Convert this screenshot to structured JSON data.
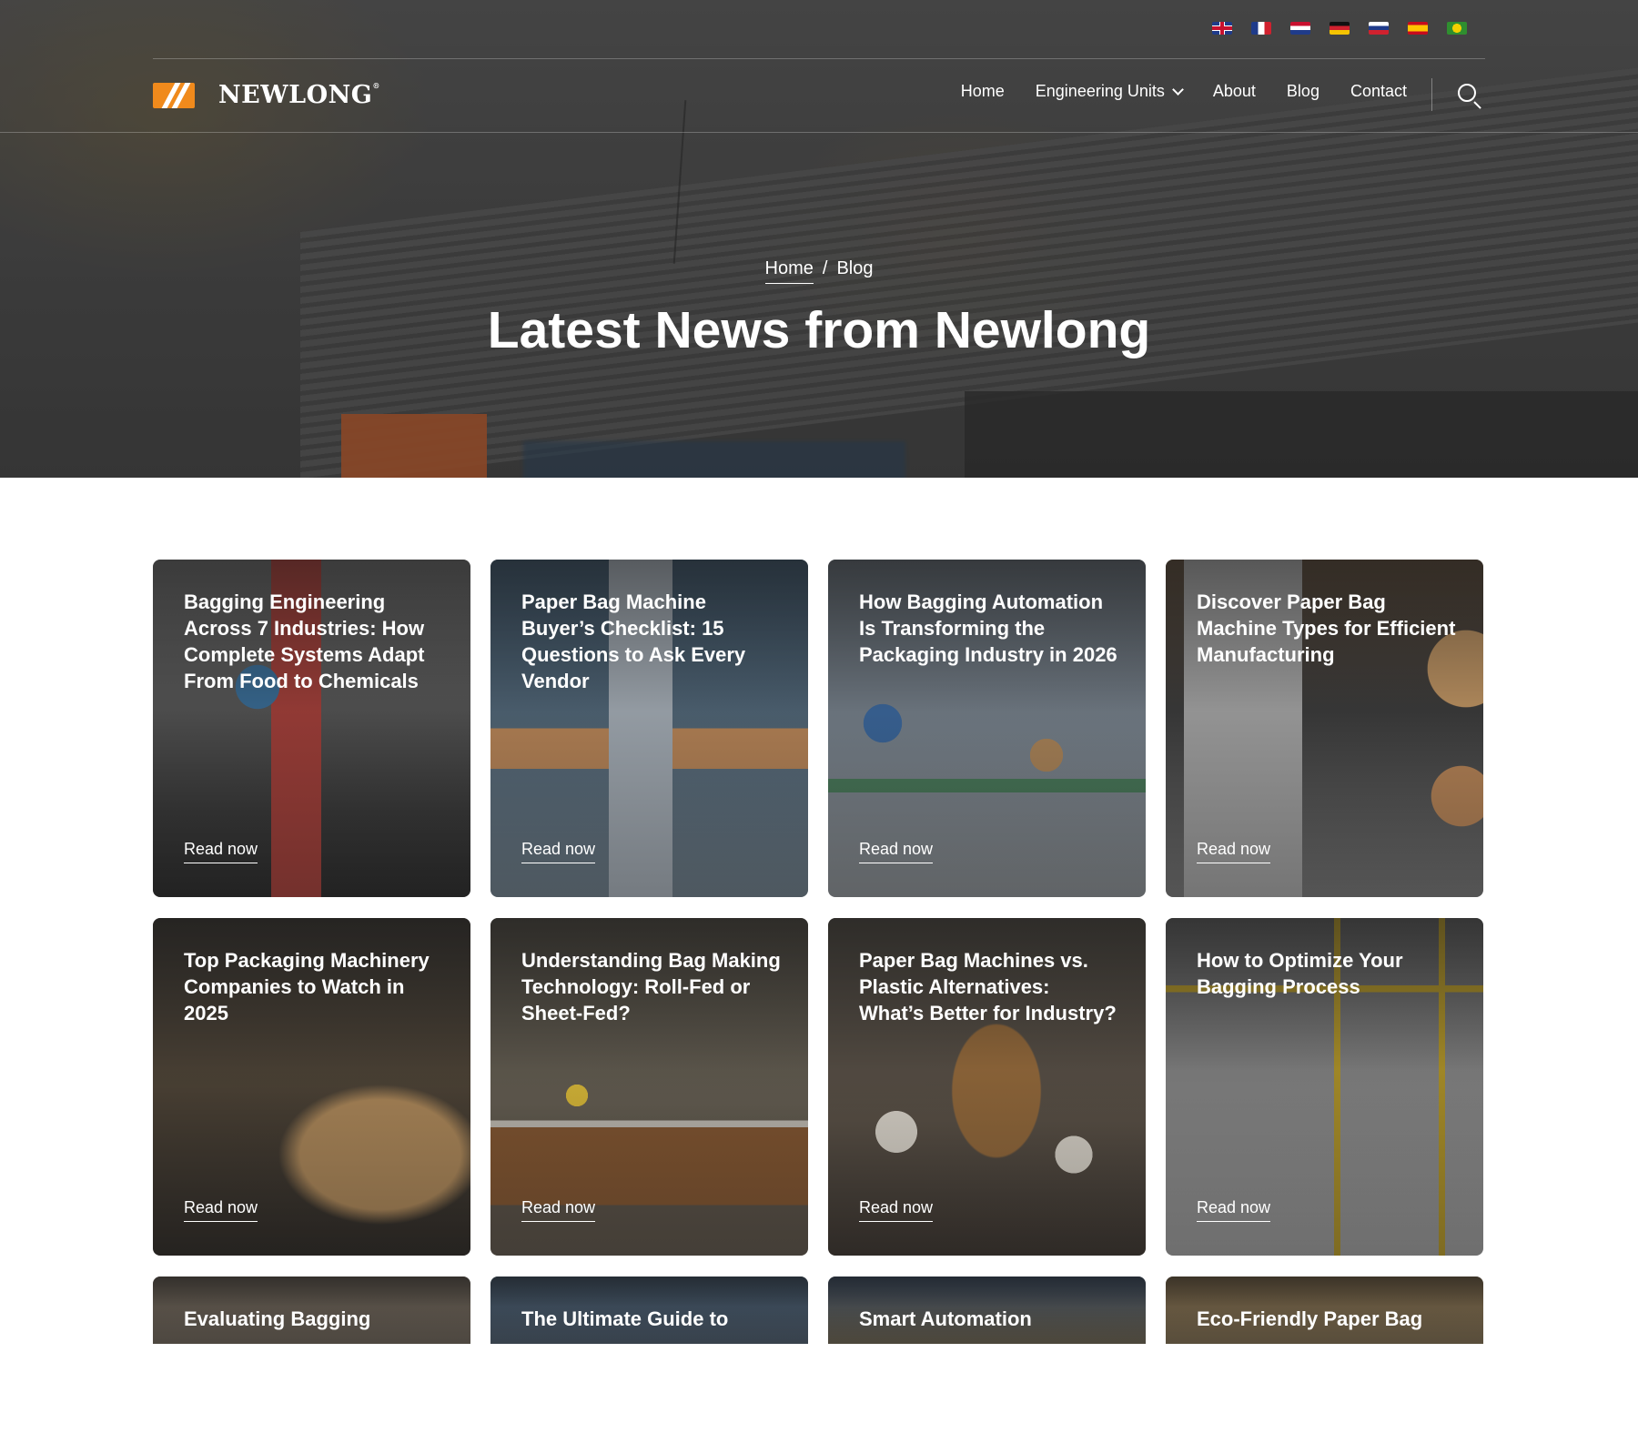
{
  "header": {
    "languages": [
      {
        "name": "English",
        "icon": "uk-flag-icon"
      },
      {
        "name": "French",
        "icon": "france-flag-icon"
      },
      {
        "name": "Dutch",
        "icon": "netherlands-flag-icon"
      },
      {
        "name": "German",
        "icon": "germany-flag-icon"
      },
      {
        "name": "Russian",
        "icon": "russia-flag-icon"
      },
      {
        "name": "Spanish",
        "icon": "spain-flag-icon"
      },
      {
        "name": "Portuguese",
        "icon": "brazil-flag-icon"
      }
    ],
    "logo_text": "NEWLONG",
    "logo_mark": "®",
    "nav": {
      "home": "Home",
      "engineering_units": "Engineering Units",
      "about": "About",
      "blog": "Blog",
      "contact": "Contact"
    }
  },
  "hero": {
    "breadcrumb": {
      "home": "Home",
      "separator": "/",
      "current": "Blog"
    },
    "title": "Latest News from Newlong"
  },
  "cards": [
    {
      "title": "Bagging Engineering Across 7 Industries: How Complete Systems Adapt From Food to Chemicals",
      "cta": "Read now"
    },
    {
      "title": "Paper Bag Machine Buyer’s Checklist: 15 Questions to Ask Every Vendor",
      "cta": "Read now"
    },
    {
      "title": "How Bagging Automation Is Transforming the Packaging Industry in 2026",
      "cta": "Read now"
    },
    {
      "title": "Discover Paper Bag Machine Types for Efficient Manufacturing",
      "cta": "Read now"
    },
    {
      "title": "Top Packaging Machinery Companies to Watch in 2025",
      "cta": "Read now"
    },
    {
      "title": "Understanding Bag Making Technology: Roll-Fed or Sheet-Fed?",
      "cta": "Read now"
    },
    {
      "title": "Paper Bag Machines vs. Plastic Alternatives: What’s Better for Industry?",
      "cta": "Read now"
    },
    {
      "title": "How to Optimize Your Bagging Process",
      "cta": "Read now"
    },
    {
      "title": "Evaluating Bagging",
      "cta": ""
    },
    {
      "title": "The Ultimate Guide to",
      "cta": ""
    },
    {
      "title": "Smart Automation",
      "cta": ""
    },
    {
      "title": "Eco-Friendly Paper Bag",
      "cta": ""
    }
  ]
}
